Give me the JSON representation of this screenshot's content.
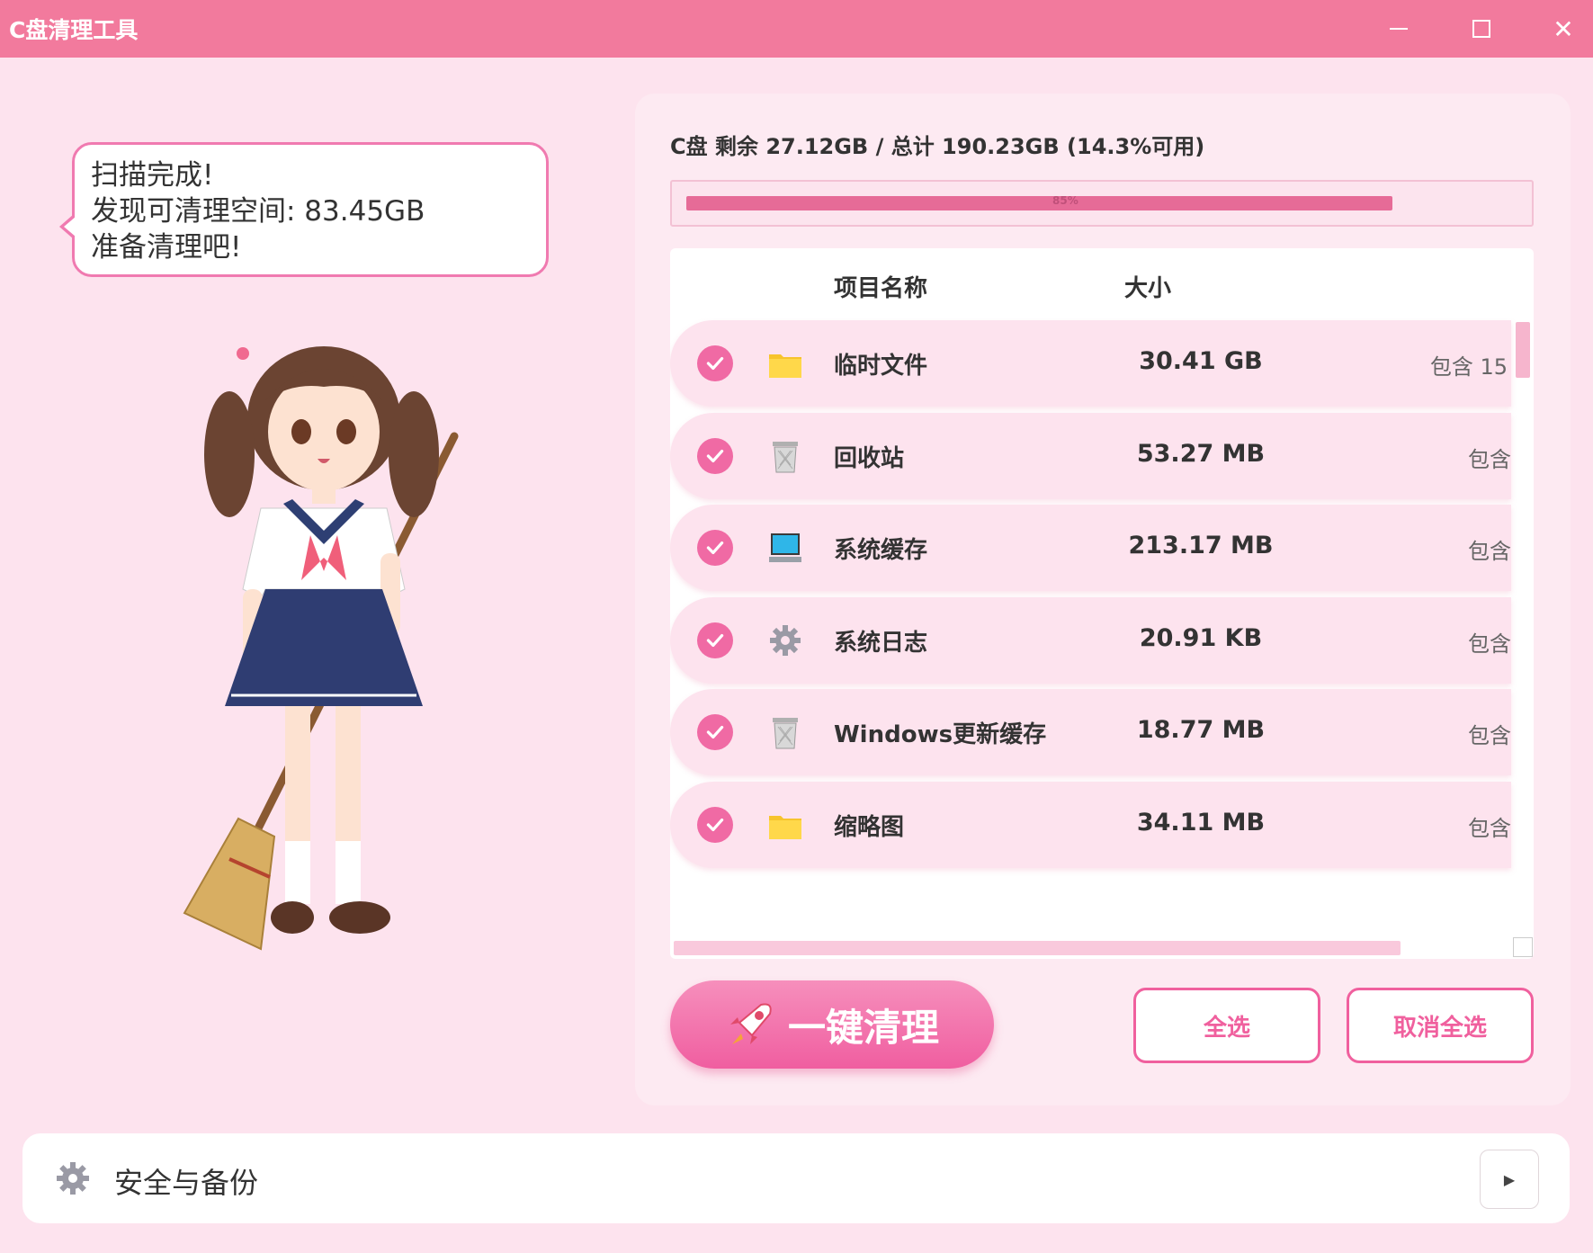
{
  "window": {
    "title": "C盘清理工具",
    "minimize": "–",
    "close": "✕"
  },
  "bubble": {
    "line1": "扫描完成!",
    "line2": "发现可清理空间: 83.45GB",
    "line3": "准备清理吧!"
  },
  "disk": {
    "summary": "C盘 剩余 27.12GB / 总计 190.23GB (14.3%可用)",
    "used_fraction": 0.857,
    "bar_label": "85%"
  },
  "list": {
    "header_name": "项目名称",
    "header_size": "大小",
    "rows": [
      {
        "name": "临时文件",
        "size": "30.41 GB",
        "desc": "包含 15",
        "icon": "folder-icon"
      },
      {
        "name": "回收站",
        "size": "53.27 MB",
        "desc": "包含",
        "icon": "recycle-bin-icon"
      },
      {
        "name": "系统缓存",
        "size": "213.17 MB",
        "desc": "包含",
        "icon": "computer-icon"
      },
      {
        "name": "系统日志",
        "size": "20.91 KB",
        "desc": "包含",
        "icon": "gear-icon"
      },
      {
        "name": "Windows更新缓存",
        "size": "18.77 MB",
        "desc": "包含",
        "icon": "recycle-bin-icon"
      },
      {
        "name": "缩略图",
        "size": "34.11 MB",
        "desc": "包含",
        "icon": "folder-icon"
      }
    ]
  },
  "actions": {
    "clean": "一键清理",
    "select_all": "全选",
    "deselect_all": "取消全选"
  },
  "bottom": {
    "label": "安全与备份",
    "expand": "▶"
  },
  "colors": {
    "titlebar": "#f27a9d",
    "accent": "#f0609e",
    "background": "#fde3ee"
  }
}
